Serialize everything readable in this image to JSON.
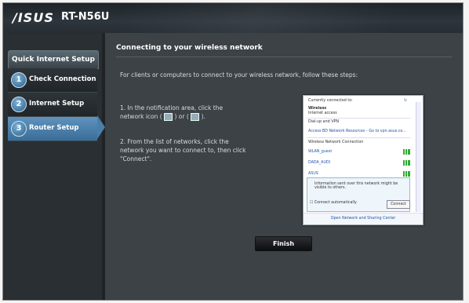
{
  "header": {
    "logo": "/ISUS",
    "model": "RT-N56U"
  },
  "sidebar": {
    "title": "Quick Internet Setup",
    "items": [
      {
        "num": "1",
        "label": "Check Connection"
      },
      {
        "num": "2",
        "label": "Internet Setup"
      },
      {
        "num": "3",
        "label": "Router Setup"
      }
    ]
  },
  "content": {
    "title": "Connecting to your wireless network",
    "intro": "For clients or computers to connect to your wireless network, follow these steps:",
    "step1_a": "1. In the notification area, click the",
    "step1_b": "network icon (",
    "step1_c": ") or (",
    "step1_d": ").",
    "step2": "2. From the list of networks, click the network you want to connect to, then click \"Connect\".",
    "finish_label": "Finish"
  },
  "popup": {
    "connected_to": "Currently connected to:",
    "net_name": "Wireless",
    "net_status": "Internet access",
    "dialup": "Dial-up and VPN",
    "vpn_item": "Access BD Network Resources - Go to vpn.asus.co...",
    "wireless_header": "Wireless Network Connection",
    "networks": [
      "WLAN_guest",
      "DADA_AUDI",
      "ASUS"
    ],
    "warning": "Information sent over this network might be visible to others.",
    "auto": "Connect automatically",
    "connect": "Connect",
    "footer": "Open Network and Sharing Center"
  },
  "colors": {
    "accent": "#4a7fa9",
    "background": "#3d4247"
  }
}
